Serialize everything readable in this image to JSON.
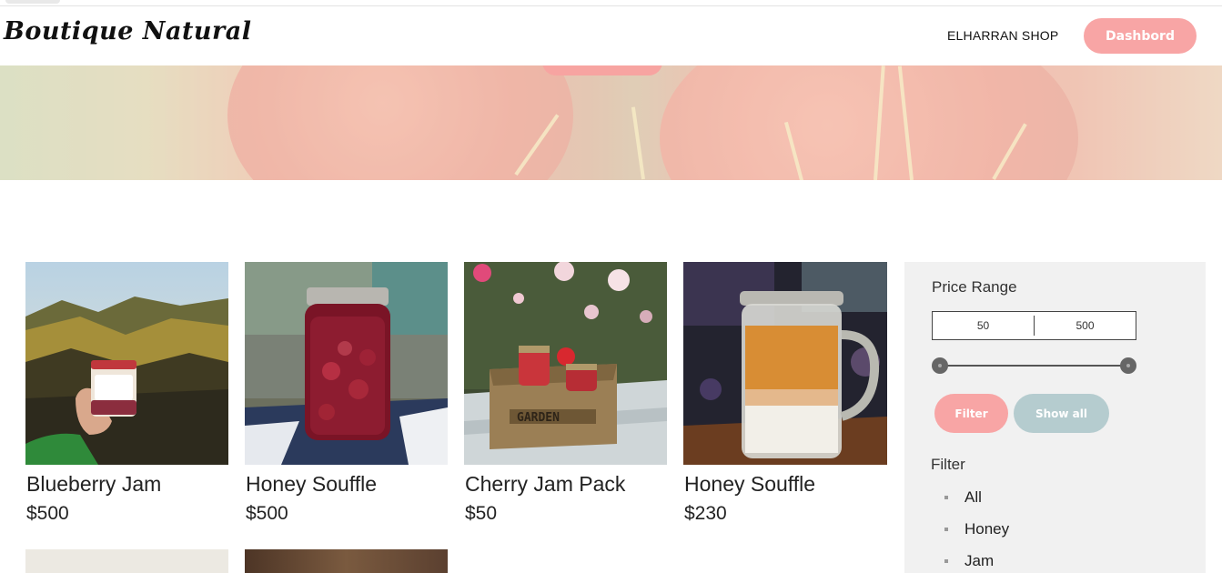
{
  "header": {
    "logo": "Boutique Natural",
    "shop_link": "ELHARRAN SHOP",
    "dashboard_label": "Dashbord"
  },
  "products": [
    {
      "name": "Blueberry Jam",
      "price": "$500"
    },
    {
      "name": "Honey Souffle",
      "price": "$500"
    },
    {
      "name": "Cherry Jam Pack",
      "price": "$50"
    },
    {
      "name": "Honey Souffle",
      "price": "$230"
    }
  ],
  "sidebar": {
    "price_range_title": "Price Range",
    "min_value": "50",
    "max_value": "500",
    "filter_label": "Filter",
    "show_all_label": "Show all",
    "filter_title": "Filter",
    "categories": [
      "All",
      "Honey",
      "Jam"
    ]
  },
  "colors": {
    "accent_pink": "#f8a5a5",
    "accent_blue_grey": "#b5cccf",
    "sidebar_bg": "#f1f1f1"
  }
}
